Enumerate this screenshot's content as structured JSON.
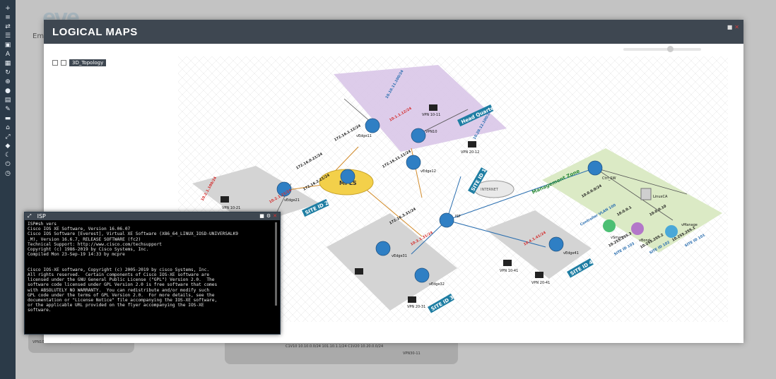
{
  "modal": {
    "title": "LOGICAL MAPS"
  },
  "background": {
    "logo_text": "eve",
    "em_text": "Em"
  },
  "tree": {
    "node_label": "3D_Topology"
  },
  "terminal": {
    "title": "ISP",
    "lines": [
      "ISP#sh vers",
      "Cisco IOS XE Software, Version 16.06.07",
      "Cisco IOS Software [Everest], Virtual XE Software (X86_64_LINUX_IOSD-UNIVERSALK9",
      ".M), Version 16.6.7, RELEASE SOFTWARE (fc2)",
      "Technical Support: http://www.cisco.com/techsupport",
      "Copyright (c) 1986-2019 by Cisco Systems, Inc.",
      "Compiled Mon 23-Sep-19 14:33 by mcpre",
      "",
      "",
      "Cisco IOS-XE software, Copyright (c) 2005-2019 by cisco Systems, Inc.",
      "All rights reserved.  Certain components of Cisco IOS-XE software are",
      "licensed under the GNU General Public License (\"GPL\") Version 2.0.  The",
      "software code licensed under GPL Version 2.0 is free software that comes",
      "with ABSOLUTELY NO WARRANTY.  You can redistribute and/or modify such",
      "GPL code under the terms of GPL Version 2.0.  For more details, see the",
      "documentation or \"License Notice\" file accompanying the IOS-XE software,",
      "or the applicable URL provided on the flyer accompanying the IOS-XE",
      "software."
    ]
  },
  "zones": {
    "head_quarter": "Head Quarter",
    "site2": "SITE ID 2",
    "site1": "SITE ID 1",
    "site3": "SITE ID 3",
    "site4": "SITE ID 4",
    "management": "Management Zone"
  },
  "clouds": {
    "mpls": "MPLS",
    "internet": "INTERNET"
  },
  "nodes": {
    "isp": "ISP",
    "vpn10": "VPN10",
    "vedge11": "vEdge11",
    "vedge12": "vEdge12",
    "vedge21": "vEdge21",
    "vedge31": "vEdge31",
    "vedge32": "vEdge32",
    "vedge41": "vEdge41",
    "ctrl_sw": "Ctrl_SW",
    "linuxca": "LinuxCA",
    "vmanage": "vManage",
    "vsmart": "vSmart",
    "vbond": "vBond",
    "vpn10_11": "VPN 10-11",
    "vpn20_12": "VPN 20-12",
    "vpn10_21": "VPN 10-21",
    "vpn20_31": "VPN 20-31",
    "vpn10_41": "VPN 10-41",
    "vpn20_41": "VPN 20-41"
  },
  "ips": {
    "a": "10.10.11.100/24",
    "b": "10.20.12.100/24",
    "c": "172.16.1.12/24",
    "d": "172.16.11.11/24",
    "e": "10.1.1.12/24",
    "f": "172.16.0.21/24",
    "g": "172.16.2.21/24",
    "h": "10.2.1.21/24",
    "i": "10.2.1.100/24",
    "j": "10.3.1.31/24",
    "k": "10.4.1.41/24",
    "l": "172.16.3.31/24",
    "m": "10.0.0.0/24",
    "n": "10.255.255.1",
    "o": "10.255.255.2",
    "p": "10.255.255.3",
    "q": "10.0.0.10",
    "r": "10.0.0.1"
  },
  "mgmt_text": {
    "controller_vlan": "Controller VLAN 100",
    "site101": "SITE ID 101",
    "site102": "SITE ID 102",
    "site103": "SITE ID 103"
  },
  "bottom_labels": {
    "a": "VPN10-71   10.2.1.100/24   10.20.71.100/24   VPN20-71",
    "b": "C1V10 10.10.0.0/24 101.10.1.1/24   C1V20 10.20.0.0/24",
    "c": "VPN30-11"
  },
  "colors": {
    "hq_zone": "#d9c6e8",
    "site_zone": "#d4d4d4",
    "mgmt_zone": "#dbeac5",
    "zone_label": "#1f7ea3",
    "ip_dark": "#1a1a1a",
    "ip_red": "#d42c2c",
    "ip_blue": "#2b6fb0",
    "router_blue": "#2f7fc4"
  },
  "toolbar_icons": [
    "plus",
    "layer",
    "settings",
    "list",
    "image",
    "text",
    "grid",
    "refresh",
    "zoom",
    "info",
    "file",
    "edit",
    "chat",
    "lock",
    "fullscreen",
    "tag",
    "moon",
    "power",
    "clock"
  ]
}
